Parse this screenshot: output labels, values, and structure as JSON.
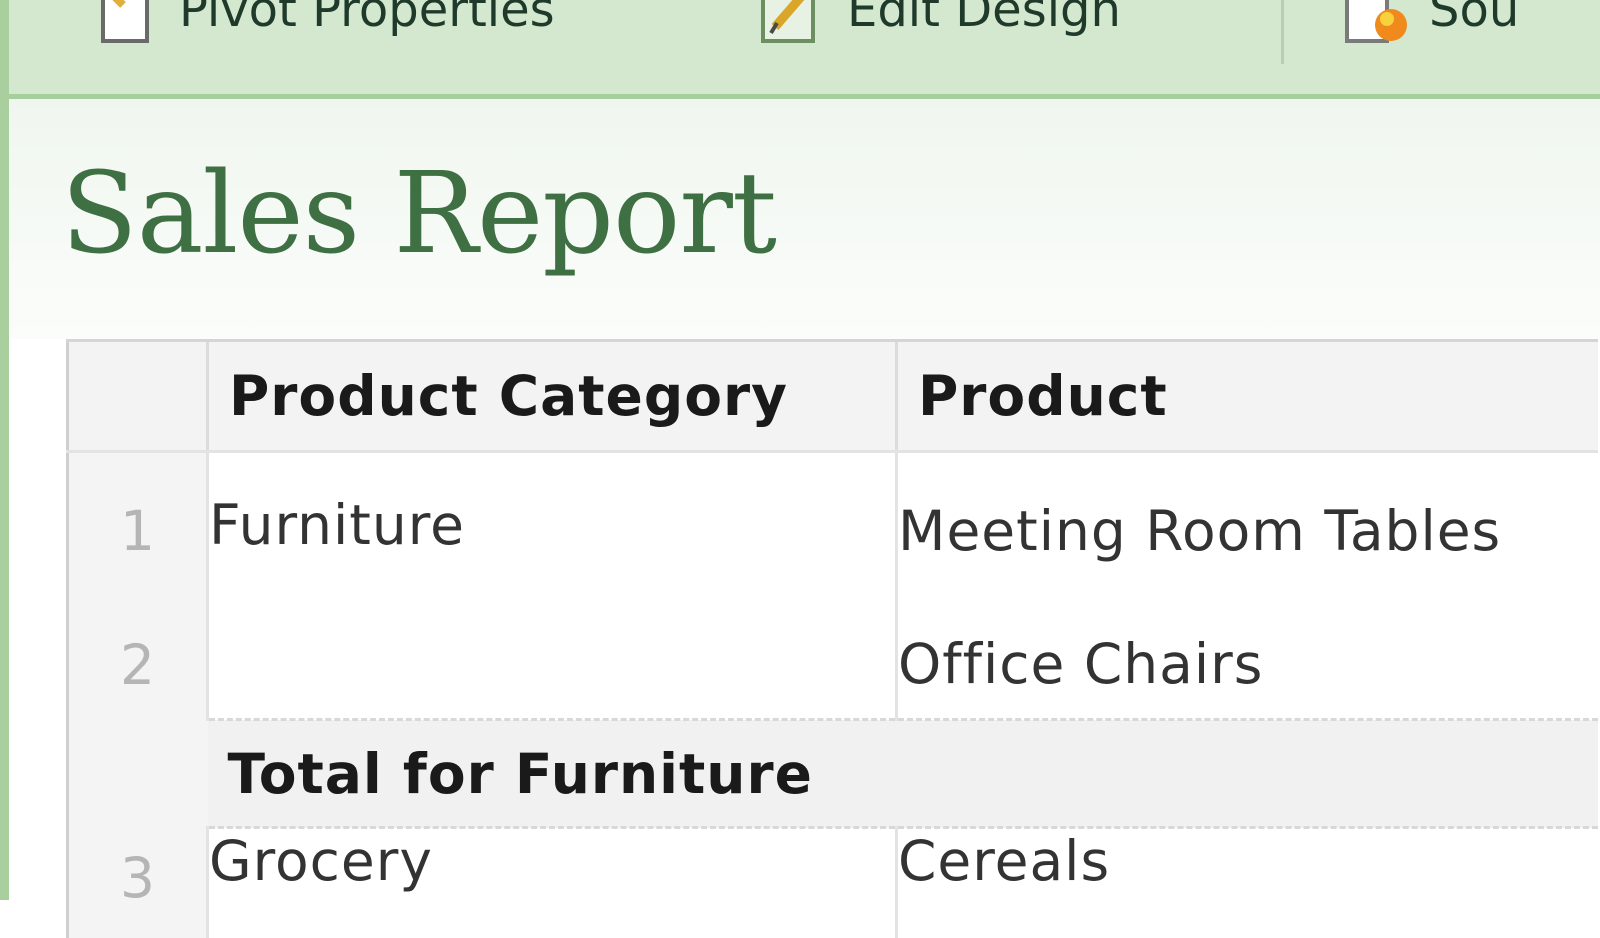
{
  "toolbar": {
    "items": [
      {
        "label": "Pivot Properties",
        "icon": "pivot-properties-icon"
      },
      {
        "label": "Edit Design",
        "icon": "edit-design-icon"
      },
      {
        "label": "Sou",
        "icon": "source-icon"
      }
    ]
  },
  "page": {
    "title": "Sales Report"
  },
  "table": {
    "headers": {
      "category": "Product Category",
      "product": "Product"
    },
    "rows": [
      {
        "num": "1",
        "category": "Furniture",
        "product": "Meeting Room Tables"
      },
      {
        "num": "2",
        "category": "",
        "product": "Office Chairs"
      }
    ],
    "total_label": "Total for Furniture",
    "next_row": {
      "num": "3",
      "category": "Grocery",
      "product": "Cereals"
    }
  },
  "colors": {
    "toolbar_bg": "#d3e8cf",
    "title_green": "#3e7043"
  }
}
